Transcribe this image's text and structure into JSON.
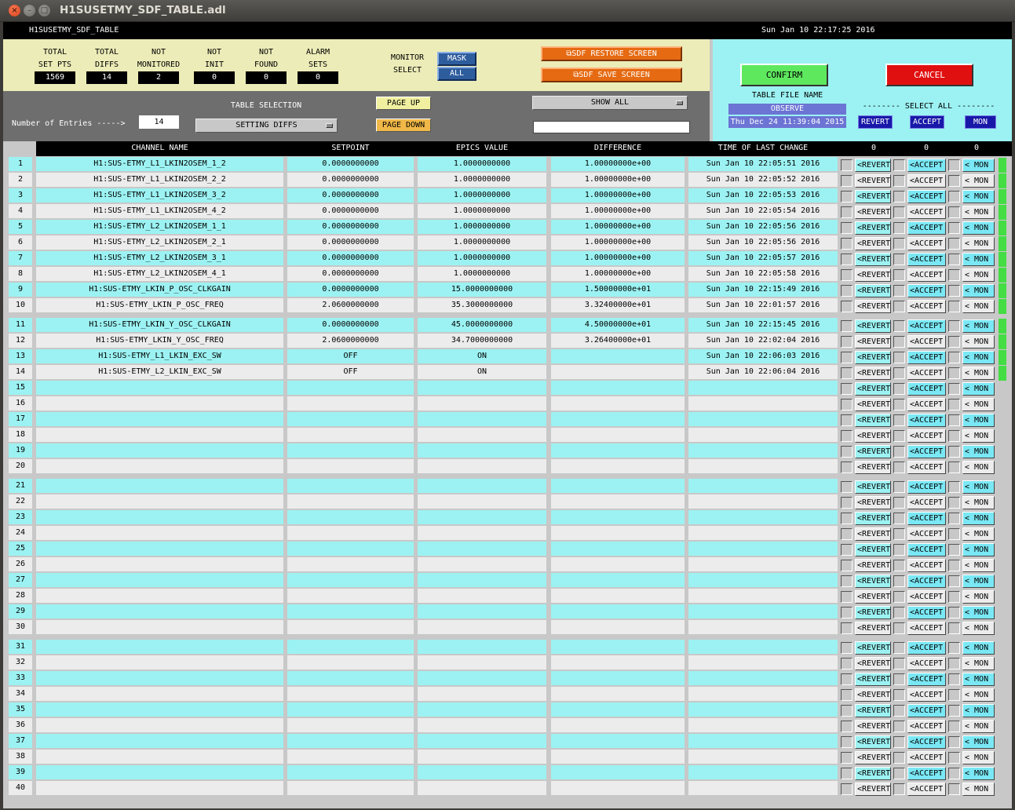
{
  "window": {
    "title": "H1SUSETMY_SDF_TABLE.adl",
    "close_glyph": "×",
    "min_glyph": "–",
    "max_glyph": "□"
  },
  "header": {
    "name": "H1SUSETMY_SDF_TABLE",
    "datetime": "Sun Jan 10 22:17:25 2016"
  },
  "stats": [
    {
      "label1": "TOTAL",
      "label2": "SET PTS",
      "value": "1569"
    },
    {
      "label1": "TOTAL",
      "label2": "DIFFS",
      "value": "14"
    },
    {
      "label1": "NOT",
      "label2": "MONITORED",
      "value": "2"
    },
    {
      "label1": "NOT",
      "label2": "INIT",
      "value": "0"
    },
    {
      "label1": "NOT",
      "label2": "FOUND",
      "value": "0"
    },
    {
      "label1": "ALARM",
      "label2": "SETS",
      "value": "0"
    }
  ],
  "monitor_select": {
    "label1": "MONITOR",
    "label2": "SELECT",
    "mask": "MASK",
    "all": "ALL"
  },
  "sdf_restore": "SDF RESTORE SCREEN",
  "sdf_save": "SDF SAVE SCREEN",
  "screen_glyph": "⧉",
  "confirm": "CONFIRM",
  "cancel": "CANCEL",
  "table_file": {
    "label": "TABLE FILE NAME",
    "value": "OBSERVE",
    "time": "Thu Dec 24 11:39:04 2015"
  },
  "select_all": {
    "label": "-------- SELECT ALL --------",
    "revert": "REVERT",
    "accept": "ACCEPT",
    "mon": "MON"
  },
  "entries": {
    "label": "Number of Entries ----->",
    "value": "14"
  },
  "table_selection": {
    "label": "TABLE SELECTION",
    "value": "SETTING DIFFS"
  },
  "page_up": "PAGE UP",
  "page_down": "PAGE DOWN",
  "show_all": "SHOW ALL",
  "filter_value": "",
  "columns": {
    "channel": "CHANNEL NAME",
    "setpoint": "SETPOINT",
    "epics": "EPICS VALUE",
    "difference": "DIFFERENCE",
    "time": "TIME OF LAST CHANGE",
    "count_revert": "0",
    "count_accept": "0",
    "count_mon": "0"
  },
  "row_buttons": {
    "revert": "<REVERT",
    "accept": "<ACCEPT",
    "mon": "< MON"
  },
  "colors": {
    "cyan_row": "#9cf2f2",
    "gray_row": "#ececec",
    "accept_cyan": "#7ae8f4",
    "flag_green": "#44dd44"
  },
  "rows": [
    {
      "n": "1",
      "channel": "H1:SUS-ETMY_L1_LKIN2OSEM_1_2",
      "setpoint": "0.0000000000",
      "epics": "1.0000000000",
      "diff": "1.00000000e+00",
      "time": "Sun Jan 10 22:05:51 2016"
    },
    {
      "n": "2",
      "channel": "H1:SUS-ETMY_L1_LKIN2OSEM_2_2",
      "setpoint": "0.0000000000",
      "epics": "1.0000000000",
      "diff": "1.00000000e+00",
      "time": "Sun Jan 10 22:05:52 2016"
    },
    {
      "n": "3",
      "channel": "H1:SUS-ETMY_L1_LKIN2OSEM_3_2",
      "setpoint": "0.0000000000",
      "epics": "1.0000000000",
      "diff": "1.00000000e+00",
      "time": "Sun Jan 10 22:05:53 2016"
    },
    {
      "n": "4",
      "channel": "H1:SUS-ETMY_L1_LKIN2OSEM_4_2",
      "setpoint": "0.0000000000",
      "epics": "1.0000000000",
      "diff": "1.00000000e+00",
      "time": "Sun Jan 10 22:05:54 2016"
    },
    {
      "n": "5",
      "channel": "H1:SUS-ETMY_L2_LKIN2OSEM_1_1",
      "setpoint": "0.0000000000",
      "epics": "1.0000000000",
      "diff": "1.00000000e+00",
      "time": "Sun Jan 10 22:05:56 2016"
    },
    {
      "n": "6",
      "channel": "H1:SUS-ETMY_L2_LKIN2OSEM_2_1",
      "setpoint": "0.0000000000",
      "epics": "1.0000000000",
      "diff": "1.00000000e+00",
      "time": "Sun Jan 10 22:05:56 2016"
    },
    {
      "n": "7",
      "channel": "H1:SUS-ETMY_L2_LKIN2OSEM_3_1",
      "setpoint": "0.0000000000",
      "epics": "1.0000000000",
      "diff": "1.00000000e+00",
      "time": "Sun Jan 10 22:05:57 2016"
    },
    {
      "n": "8",
      "channel": "H1:SUS-ETMY_L2_LKIN2OSEM_4_1",
      "setpoint": "0.0000000000",
      "epics": "1.0000000000",
      "diff": "1.00000000e+00",
      "time": "Sun Jan 10 22:05:58 2016"
    },
    {
      "n": "9",
      "channel": "H1:SUS-ETMY_LKIN_P_OSC_CLKGAIN",
      "setpoint": "0.0000000000",
      "epics": "15.0000000000",
      "diff": "1.50000000e+01",
      "time": "Sun Jan 10 22:15:49 2016"
    },
    {
      "n": "10",
      "channel": "H1:SUS-ETMY_LKIN_P_OSC_FREQ",
      "setpoint": "2.0600000000",
      "epics": "35.3000000000",
      "diff": "3.32400000e+01",
      "time": "Sun Jan 10 22:01:57 2016"
    },
    {
      "n": "11",
      "channel": "H1:SUS-ETMY_LKIN_Y_OSC_CLKGAIN",
      "setpoint": "0.0000000000",
      "epics": "45.0000000000",
      "diff": "4.50000000e+01",
      "time": "Sun Jan 10 22:15:45 2016"
    },
    {
      "n": "12",
      "channel": "H1:SUS-ETMY_LKIN_Y_OSC_FREQ",
      "setpoint": "2.0600000000",
      "epics": "34.7000000000",
      "diff": "3.26400000e+01",
      "time": "Sun Jan 10 22:02:04 2016"
    },
    {
      "n": "13",
      "channel": "H1:SUS-ETMY_L1_LKIN_EXC_SW",
      "setpoint": "OFF",
      "epics": "ON",
      "diff": "",
      "time": "Sun Jan 10 22:06:03 2016"
    },
    {
      "n": "14",
      "channel": "H1:SUS-ETMY_L2_LKIN_EXC_SW",
      "setpoint": "OFF",
      "epics": "ON",
      "diff": "",
      "time": "Sun Jan 10 22:06:04 2016"
    },
    {
      "n": "15"
    },
    {
      "n": "16"
    },
    {
      "n": "17"
    },
    {
      "n": "18"
    },
    {
      "n": "19"
    },
    {
      "n": "20"
    },
    {
      "n": "21"
    },
    {
      "n": "22"
    },
    {
      "n": "23"
    },
    {
      "n": "24"
    },
    {
      "n": "25"
    },
    {
      "n": "26"
    },
    {
      "n": "27"
    },
    {
      "n": "28"
    },
    {
      "n": "29"
    },
    {
      "n": "30"
    },
    {
      "n": "31"
    },
    {
      "n": "32"
    },
    {
      "n": "33"
    },
    {
      "n": "34"
    },
    {
      "n": "35"
    },
    {
      "n": "36"
    },
    {
      "n": "37"
    },
    {
      "n": "38"
    },
    {
      "n": "39"
    },
    {
      "n": "40"
    }
  ]
}
